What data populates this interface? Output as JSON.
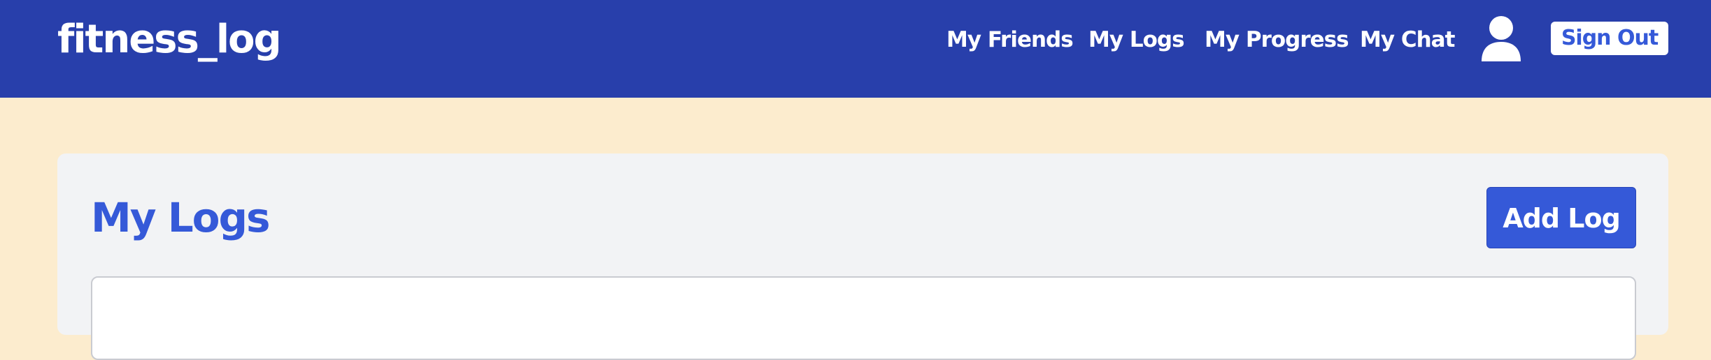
{
  "navbar": {
    "brand": "fitness_log",
    "links": [
      "My Friends",
      "My Logs",
      "My Progress",
      "My Chat"
    ],
    "user_icon": "user-icon",
    "signout_label": "Sign Out"
  },
  "main": {
    "title": "My Logs",
    "add_button_label": "Add Log"
  },
  "colors": {
    "navbar_bg": "#283fab",
    "page_bg": "#fcecce",
    "card_bg": "#f2f3f5",
    "accent": "#3559d8"
  }
}
